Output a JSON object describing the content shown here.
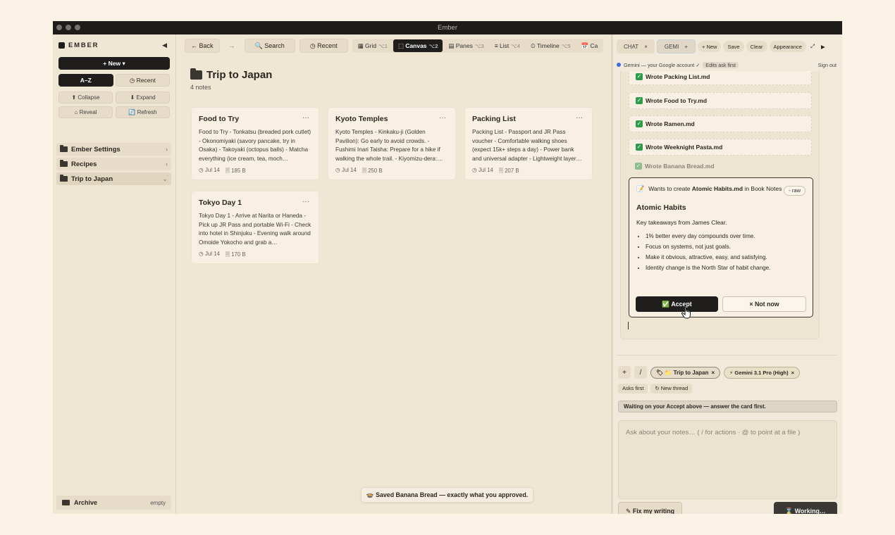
{
  "window": {
    "title": "Ember"
  },
  "sidebar": {
    "brand": "EMBER",
    "collapse_icon": "◀",
    "new_label": "+ New ▾",
    "sort_az": "A–Z",
    "sort_recent": "◷ Recent",
    "collapse": "⬆ Collapse",
    "expand": "⬇ Expand",
    "reveal": "⌂ Reveal",
    "refresh": "🔄 Refresh",
    "folders": [
      {
        "name": "Ember Settings",
        "chevron": "›"
      },
      {
        "name": "Recipes",
        "chevron": "›"
      },
      {
        "name": "Trip to Japan",
        "chevron": "⌄"
      }
    ],
    "archive": {
      "label": "Archive",
      "status": "empty"
    }
  },
  "toolbar": {
    "back": "← Back",
    "forward": "→",
    "search": "🔍 Search",
    "recent": "◷ Recent",
    "views": [
      {
        "label": "▦ Grid",
        "key": "⌥1"
      },
      {
        "label": "⬚ Canvas",
        "key": "⌥2"
      },
      {
        "label": "▤ Panes",
        "key": "⌥3"
      },
      {
        "label": "≡ List",
        "key": "⌥4"
      },
      {
        "label": "⏲ Timeline",
        "key": "⌥5"
      },
      {
        "label": "📅 Ca",
        "key": ""
      }
    ]
  },
  "main": {
    "title": "Trip to Japan",
    "subtitle": "4 notes",
    "cards": [
      {
        "title": "Food to Try",
        "more": "···",
        "body": "Food to Try - Tonkatsu (breaded pork cutlet) - Okonomiyaki (savory pancake, try in Osaka) - Takoyaki (octopus balls) - Matcha everything (ice cream, tea, moch…",
        "date": "◷ Jul 14",
        "size": "🗏 185 B"
      },
      {
        "title": "Kyoto Temples",
        "more": "···",
        "body": "Kyoto Temples - Kinkaku-ji (Golden Pavilion): Go early to avoid crowds. - Fushimi Inari Taisha: Prepare for a hike if walking the whole trail. - Kiyomizu-dera:…",
        "date": "◷ Jul 14",
        "size": "🗏 250 B"
      },
      {
        "title": "Packing List",
        "more": "···",
        "body": "Packing List - Passport and JR Pass voucher - Comfortable walking shoes (expect 15k+ steps a day) - Power bank and universal adapter - Lightweight layer…",
        "date": "◷ Jul 14",
        "size": "🗏 207 B"
      },
      {
        "title": "Tokyo Day 1",
        "more": "···",
        "body": "Tokyo Day 1 - Arrive at Narita or Haneda - Pick up JR Pass and portable Wi-Fi - Check into hotel in Shinjuku - Evening walk around Omoide Yokocho and grab a…",
        "date": "◷ Jul 14",
        "size": "🗏 170 B"
      }
    ],
    "toast": "🍲 Saved Banana Bread — exactly what you approved."
  },
  "panel": {
    "tabs": [
      {
        "label": "CHAT",
        "close": "×"
      },
      {
        "label": "GEMI",
        "close": "+"
      }
    ],
    "buttons": [
      "+ New",
      "Save",
      "Clear",
      "Appearance"
    ],
    "expand_icon": "⤢",
    "play_icon": "▶",
    "account_text": "Gemini — your Google account ✓",
    "edits_chip": "Edits ask first",
    "signout": "Sign out",
    "wrote": [
      "Wrote Packing List.md",
      "Wrote Food to Try.md",
      "Wrote Ramen.md",
      "Wrote Weeknight Pasta.md",
      "Wrote Banana Bread.md"
    ],
    "check": "✓",
    "approval": {
      "icon": "📝",
      "prefix": "Wants to create ",
      "file": "Atomic Habits.md",
      "middle": " in Book Notes",
      "raw": "◦ raw",
      "title": "Atomic Habits",
      "desc": "Key takeaways from James Clear.",
      "items": [
        "1% better every day compounds over time.",
        "Focus on systems, not just goals.",
        "Make it obvious, attractive, easy, and satisfying.",
        "Identity change is the North Star of habit change."
      ],
      "accept": "✅ Accept",
      "notnow": "× Not now"
    },
    "plus": "+",
    "slash": "/",
    "context_pill": "🏷 📁 Trip to Japan",
    "pill_close": "×",
    "model_pill": "⚡ Gemini 3.1 Pro (High)",
    "asks_first": "Asks first",
    "new_thread": "↻ New thread",
    "waiting": "Waiting on your Accept above — answer the card first.",
    "placeholder": "Ask about your notes…   ( / for actions · @ to point at a file )",
    "fix": "✎ Fix my writing",
    "working": "⌛ Working…"
  }
}
